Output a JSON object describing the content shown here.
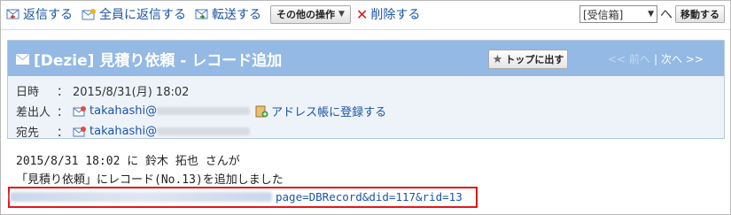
{
  "toolbar": {
    "reply": "返信する",
    "reply_all": "全員に返信する",
    "forward": "転送する",
    "other_ops": "その他の操作",
    "delete": "削除する",
    "folder_selected": "[受信箱]",
    "he": "へ",
    "move": "移動する"
  },
  "message": {
    "subject": "[Dezie] 見積り依頼 - レコード追加",
    "to_top": "トップに出す",
    "prev": "<< 前へ",
    "next": "次へ >>",
    "date_label": "日時",
    "date_value": "2015/8/31(月) 18:02",
    "from_label": "差出人",
    "from_user": "takahashi@",
    "add_address": "アドレス帳に登録する",
    "to_label": "宛先",
    "to_user": "takahashi@",
    "colon": "："
  },
  "body": {
    "line1": "2015/8/31 18:02 に 鈴木 拓也 さんが",
    "line2": "「見積り依頼」にレコード(No.13)を追加しました",
    "url_suffix": "page=DBRecord&did=117&rid=13"
  },
  "colors": {
    "link": "#1a55a8",
    "header_bg": "#93b9e4",
    "info_bg": "#eef3f9",
    "highlight_border": "#e01818"
  }
}
